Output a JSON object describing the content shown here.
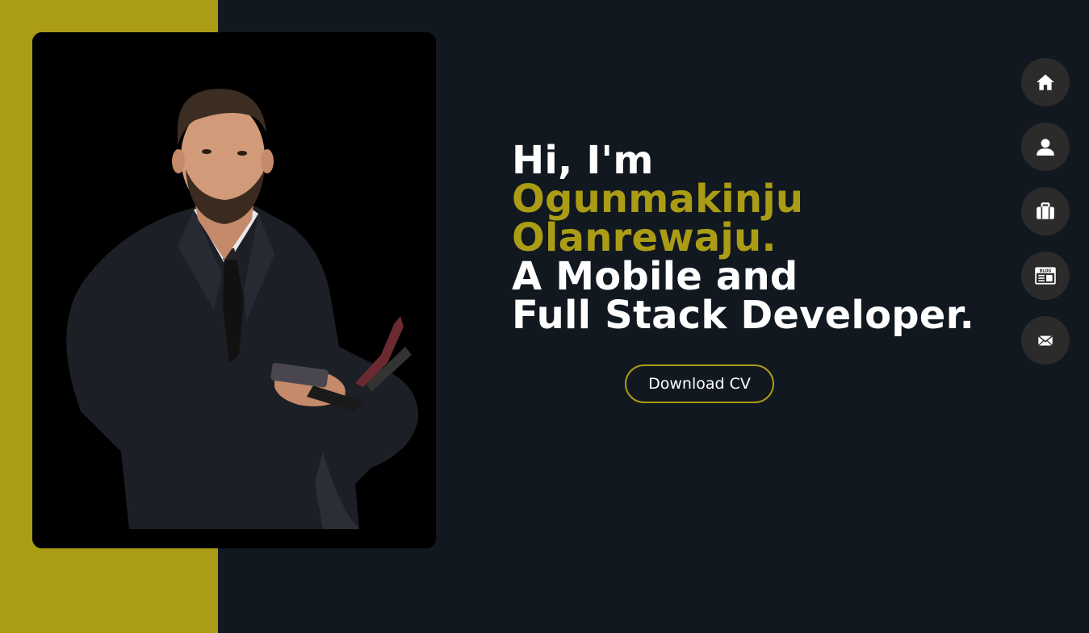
{
  "colors": {
    "accent": "#ab9c15",
    "background": "#111820",
    "nav_button_bg": "#2b2b2b",
    "text": "#ffffff"
  },
  "hero": {
    "greeting": "Hi, I'm",
    "name_line_1": "Ogunmakinju",
    "name_line_2": "Olanrewaju.",
    "role_line_1": "A Mobile and",
    "role_line_2": "Full Stack Developer."
  },
  "cta": {
    "download_label": "Download CV"
  },
  "nav": {
    "items": [
      {
        "id": "home",
        "icon": "home-icon"
      },
      {
        "id": "about",
        "icon": "user-icon"
      },
      {
        "id": "portfolio",
        "icon": "briefcase-icon"
      },
      {
        "id": "blog",
        "icon": "blog-icon",
        "icon_text": "BLOG"
      },
      {
        "id": "contact",
        "icon": "mail-icon"
      }
    ]
  }
}
